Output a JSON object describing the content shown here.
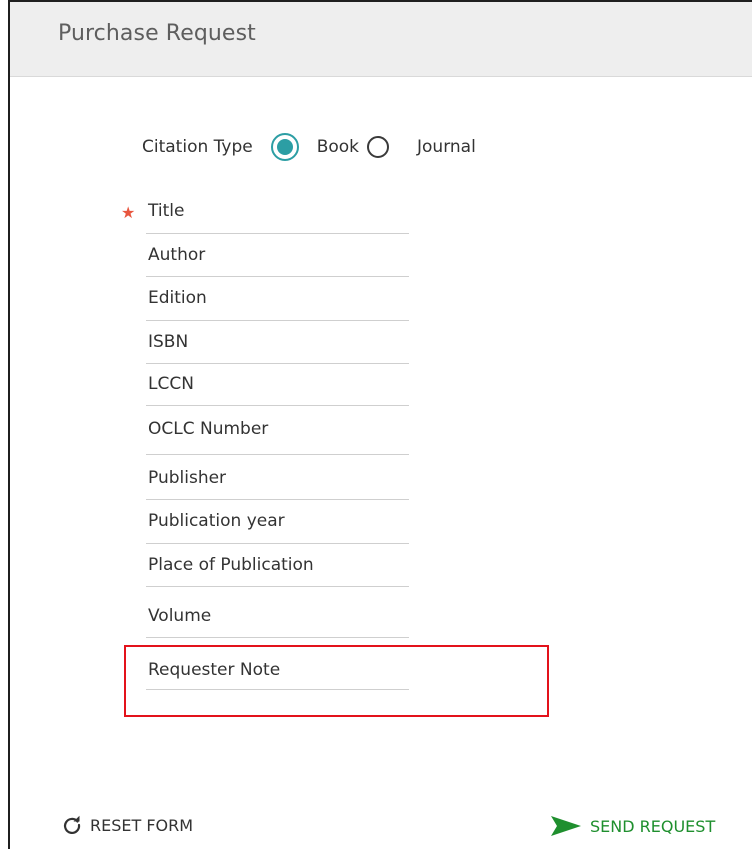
{
  "panel": {
    "title": "Purchase Request"
  },
  "citation": {
    "label": "Citation Type",
    "options": [
      {
        "label": "Book",
        "selected": true
      },
      {
        "label": "Journal",
        "selected": false
      }
    ]
  },
  "fields": [
    {
      "label": "Title",
      "required": true
    },
    {
      "label": "Author"
    },
    {
      "label": "Edition"
    },
    {
      "label": "ISBN"
    },
    {
      "label": "LCCN"
    },
    {
      "label": "OCLC Number"
    },
    {
      "label": "Publisher"
    },
    {
      "label": "Publication year"
    },
    {
      "label": "Place of Publication"
    },
    {
      "label": "Volume"
    },
    {
      "label": "Requester Note"
    }
  ],
  "actions": {
    "reset_label": "RESET FORM",
    "send_label": "SEND REQUEST"
  },
  "colors": {
    "accent_teal": "#2c9ea4",
    "required_star": "#e8563f",
    "send_green": "#1f8f2e",
    "highlight_red": "#e3121b"
  },
  "icons": {
    "reset": "refresh-icon",
    "send": "send-arrow-icon",
    "required": "asterisk-star"
  }
}
